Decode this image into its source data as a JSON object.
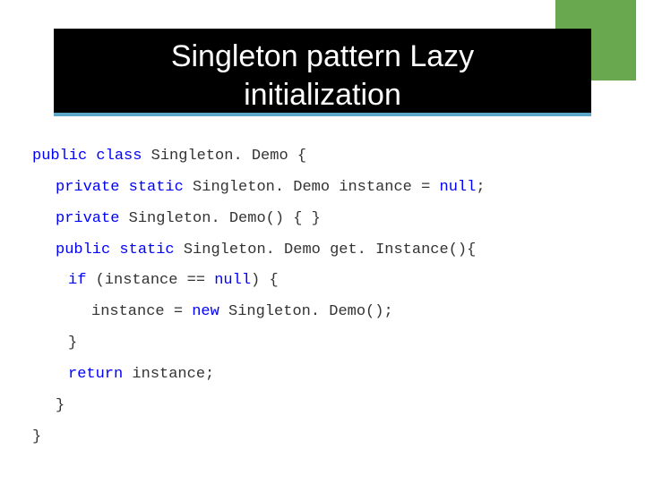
{
  "title_line1": "Singleton pattern Lazy",
  "title_line2": "initialization",
  "code": {
    "l1": {
      "k1": "public",
      "t1": " ",
      "k2": "class",
      "t2": " Singleton. Demo {"
    },
    "l2": {
      "k1": "private",
      "t1": " ",
      "k2": "static",
      "t2": " Singleton. Demo instance = ",
      "k3": "null",
      "t3": ";"
    },
    "l3": {
      "k1": "private",
      "t1": " Singleton. Demo() { }"
    },
    "l4": {
      "k1": "public",
      "t1": " ",
      "k2": "static",
      "t2": " Singleton. Demo get. Instance(){"
    },
    "l5": {
      "k1": "if",
      "t1": " (instance == ",
      "k2": "null",
      "t2": ") {"
    },
    "l6": {
      "t1": "instance = ",
      "k1": "new",
      "t2": " Singleton. Demo();"
    },
    "l7": {
      "t1": "}"
    },
    "l8": {
      "k1": "return",
      "t1": " instance;"
    },
    "l9": {
      "t1": "}"
    },
    "l10": {
      "t1": "}"
    }
  }
}
